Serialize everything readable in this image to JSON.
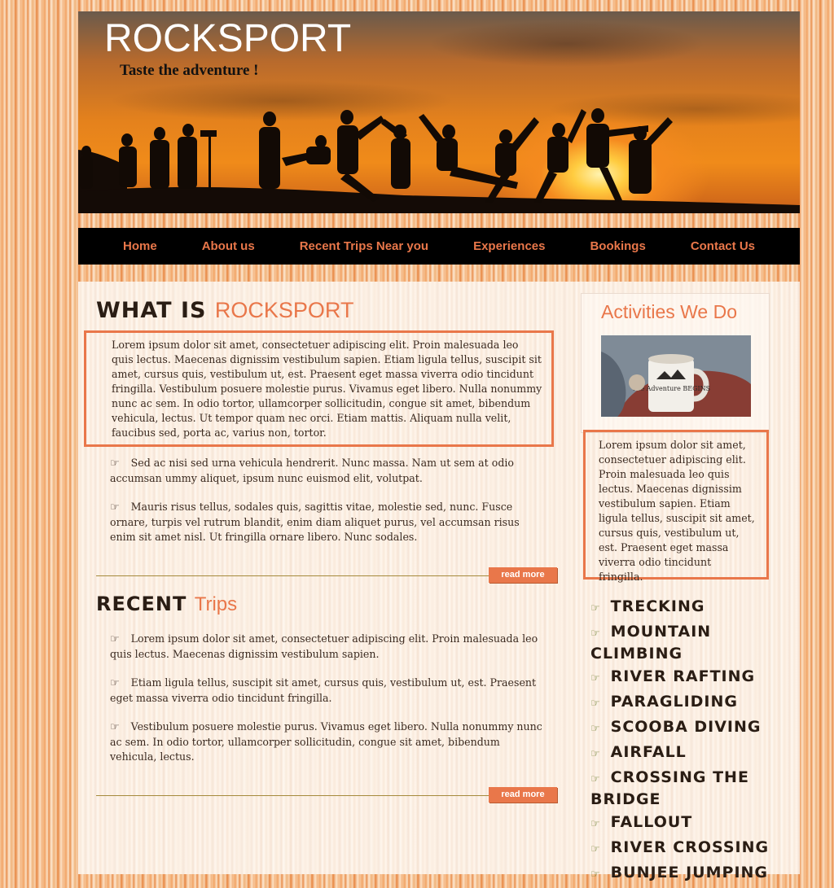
{
  "header": {
    "title": "ROCKSPORT",
    "tagline": "Taste the adventure !"
  },
  "nav": {
    "items": [
      "Home",
      "About us",
      "Recent Trips Near you",
      "Experiences",
      "Bookings",
      "Contact Us"
    ]
  },
  "what_is": {
    "heading_dark": "WHAT IS",
    "heading_accent": "ROCKSPORT",
    "intro": "Lorem ipsum dolor sit amet, consectetuer adipiscing elit. Proin malesuada leo quis lectus. Maecenas dignissim vestibulum sapien. Etiam ligula tellus, suscipit sit amet, cursus quis, vestibulum ut, est. Praesent eget massa viverra odio tincidunt fringilla. Vestibulum posuere molestie purus. Vivamus eget libero. Nulla nonummy nunc ac sem. In odio tortor, ullamcorper sollicitudin, congue sit amet, bibendum vehicula, lectus. Ut tempor quam nec orci. Etiam mattis. Aliquam nulla velit, faucibus sed, porta ac, varius non, tortor.",
    "bullets": [
      "Sed ac nisi sed urna vehicula hendrerit. Nunc massa. Nam ut sem at odio accumsan ummy aliquet, ipsum nunc euismod elit, volutpat.",
      "Mauris risus tellus, sodales quis, sagittis vitae, molestie sed, nunc. Fusce ornare, turpis vel rutrum blandit, enim diam aliquet purus, vel accumsan risus enim sit amet nisl. Ut fringilla ornare libero. Nunc sodales."
    ],
    "read_more": "read more"
  },
  "recent": {
    "heading_dark": "RECENT",
    "heading_accent": "Trips",
    "bullets": [
      "Lorem ipsum dolor sit amet, consectetuer adipiscing elit. Proin malesuada leo quis lectus. Maecenas dignissim vestibulum sapien.",
      "Etiam ligula tellus, suscipit sit amet, cursus quis, vestibulum ut, est. Praesent eget massa viverra odio tincidunt fringilla.",
      "Vestibulum posuere molestie purus. Vivamus eget libero. Nulla nonummy nunc ac sem. In odio tortor, ullamcorper sollicitudin, congue sit amet, bibendum vehicula, lectus."
    ],
    "read_more": "read more"
  },
  "sidebar": {
    "title": "Activities We Do",
    "mug_text": "The Adventure BEGINS",
    "blurb": "Lorem ipsum dolor sit amet, consectetuer adipiscing elit. Proin malesuada leo quis lectus. Maecenas dignissim vestibulum sapien. Etiam ligula tellus, suscipit sit amet, cursus quis, vestibulum ut, est. Praesent eget massa viverra odio tincidunt fringilla.",
    "activities": [
      "Trecking",
      "Mountain Climbing",
      "River Rafting",
      "Paragliding",
      "Scooba Diving",
      "Airfall",
      "Crossing the Bridge",
      "Fallout",
      "River Crossing",
      "Bunjee Jumping"
    ]
  },
  "colors": {
    "accent": "#e9774a",
    "nav_bg": "#000000",
    "heading_dark": "#2a1d14"
  },
  "icons": {
    "bullet": "pointing-hand-icon"
  }
}
